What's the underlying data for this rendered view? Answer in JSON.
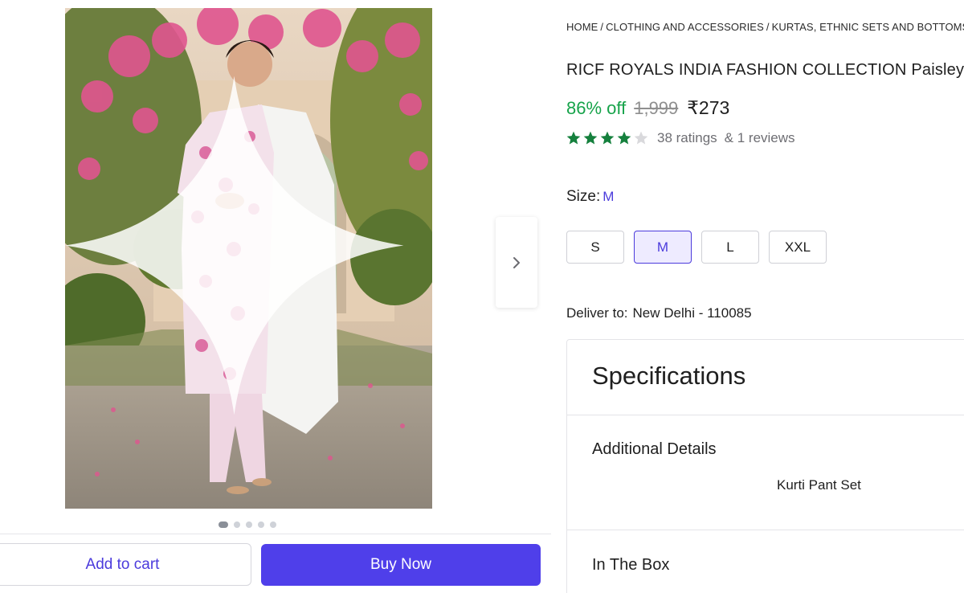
{
  "breadcrumb": {
    "items": [
      "HOME",
      "CLOTHING AND ACCESSORIES",
      "KURTAS, ETHNIC SETS AND BOTTOMS"
    ],
    "separator": "/"
  },
  "product": {
    "title": "RICF ROYALS INDIA FASHION COLLECTION Paisley",
    "discount": "86% off",
    "mrp": "1,999",
    "price": "₹273",
    "rating_stars": 4,
    "rating_max": 5,
    "ratings_count": "38 ratings",
    "reviews_count": "& 1 reviews",
    "image_description": "model-photo"
  },
  "gallery": {
    "image_count": 5,
    "active_index": 0,
    "next_icon": "chevron-right-icon"
  },
  "size": {
    "label": "Size:",
    "selected": "M",
    "options": [
      "S",
      "M",
      "L",
      "XXL"
    ]
  },
  "delivery": {
    "label": "Deliver to:",
    "location": "New Delhi - 110085"
  },
  "specifications": {
    "title": "Specifications",
    "additional_details_title": "Additional Details",
    "additional_details_value": "Kurti Pant Set",
    "in_the_box_title": "In The Box"
  },
  "actions": {
    "add_to_cart": "Add to cart",
    "buy_now": "Buy Now"
  },
  "colors": {
    "accent": "#4f3fea",
    "discount_green": "#16a34a",
    "star_green": "#15803d"
  }
}
